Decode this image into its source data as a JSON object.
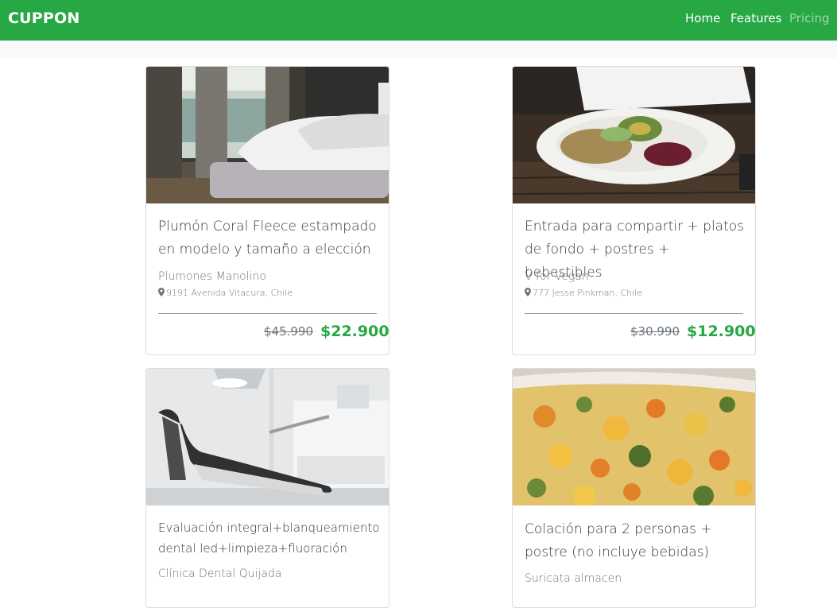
{
  "navbar": {
    "brand": "CUPPON",
    "links": [
      {
        "label": "Home"
      },
      {
        "label": "Features"
      },
      {
        "label": "Pricing"
      }
    ]
  },
  "deals": [
    {
      "image": "bedroom-photo",
      "title": "Plumón Coral Fleece estampado en modelo y tamaño a elección",
      "merchant": "Plumones Manolino",
      "address": "9191 Avenida Vitacura, Chile",
      "old_price": "$45.990",
      "new_price": "$22.900"
    },
    {
      "image": "salad-plate-photo",
      "title": "Entrada para compartir + platos de fondo + postres + bebestibles",
      "merchant": "V for Vegan",
      "address": "777 Jesse Pinkman, Chile",
      "old_price": "$30.990",
      "new_price": "$12.900"
    },
    {
      "image": "dental-chair-photo",
      "title": "Evaluación integral+blanqueamiento dental led+limpieza+fluoración",
      "merchant": "Clínica Dental Quijada"
    },
    {
      "image": "vegetable-dish-photo",
      "title": "Colación para 2 personas + postre (no incluye bebidas)",
      "merchant": "Suricata almacen"
    }
  ],
  "colors": {
    "brand_green": "#28a745",
    "muted_text": "#6c757d"
  },
  "icons": {
    "location": "map-marker-icon"
  }
}
